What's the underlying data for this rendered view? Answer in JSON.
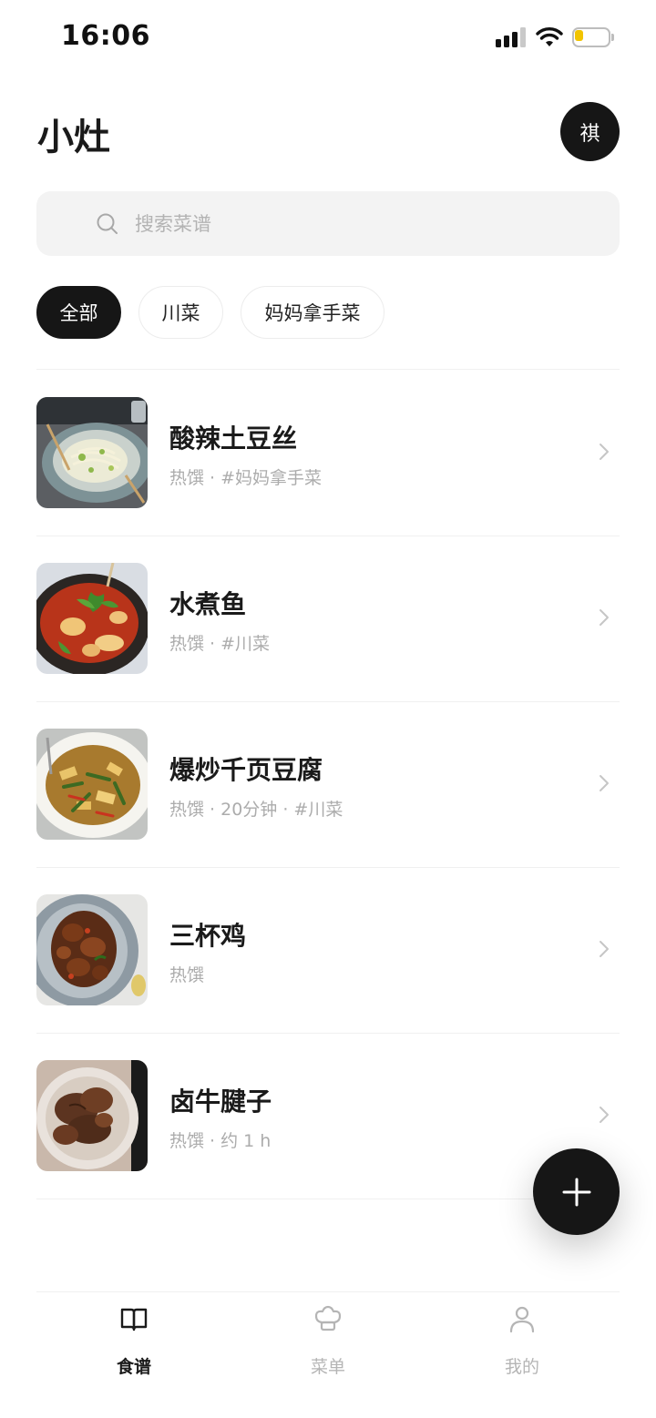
{
  "status_bar": {
    "time": "16:06"
  },
  "header": {
    "title": "小灶",
    "avatar_initial": "祺"
  },
  "search": {
    "placeholder": "搜索菜谱",
    "value": ""
  },
  "filters": [
    {
      "label": "全部",
      "active": true
    },
    {
      "label": "川菜",
      "active": false
    },
    {
      "label": "妈妈拿手菜",
      "active": false
    }
  ],
  "recipes": [
    {
      "name": "酸辣土豆丝",
      "meta": "热馔 · #妈妈拿手菜"
    },
    {
      "name": "水煮鱼",
      "meta": "热馔 · #川菜"
    },
    {
      "name": "爆炒千页豆腐",
      "meta": "热馔 · 20分钟 · #川菜"
    },
    {
      "name": "三杯鸡",
      "meta": "热馔"
    },
    {
      "name": "卤牛腱子",
      "meta": "热馔 · 约 1 h"
    }
  ],
  "tabbar": {
    "items": [
      {
        "label": "食谱",
        "icon": "book-icon",
        "active": true
      },
      {
        "label": "菜单",
        "icon": "chef-hat-icon",
        "active": false
      },
      {
        "label": "我的",
        "icon": "person-icon",
        "active": false
      }
    ]
  },
  "colors": {
    "accent": "#161616",
    "muted_text": "#acacac",
    "search_bg": "#f3f3f3",
    "battery_fill": "#f2c400"
  }
}
